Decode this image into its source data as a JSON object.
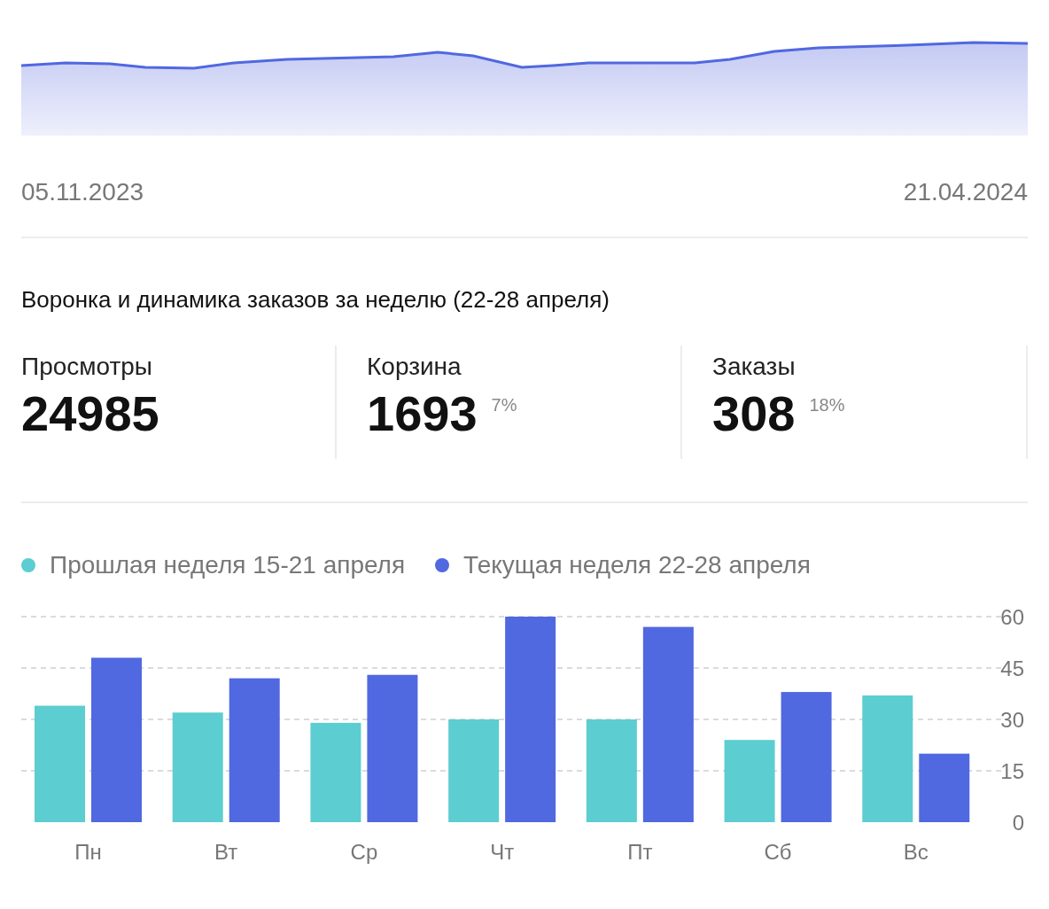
{
  "sparkline": {
    "start_date": "05.11.2023",
    "end_date": "21.04.2024"
  },
  "funnel": {
    "title": "Воронка и динамика заказов за неделю (22-28 апреля)",
    "metrics": [
      {
        "label": "Просмотры",
        "value": "24985"
      },
      {
        "label": "Корзина",
        "value": "1693",
        "percent": "7%"
      },
      {
        "label": "Заказы",
        "value": "308",
        "percent": "18%"
      }
    ]
  },
  "orders_chart": {
    "chart_data": {
      "type": "bar",
      "grid": true,
      "categories": [
        "Пн",
        "Вт",
        "Ср",
        "Чт",
        "Пт",
        "Сб",
        "Вс"
      ],
      "ylim": [
        0,
        60
      ],
      "yticks": [
        0,
        15,
        30,
        45,
        60
      ],
      "series": [
        {
          "name": "Прошлая неделя 15-21 апреля",
          "color": "#5ccdd0",
          "values": [
            34,
            32,
            29,
            30,
            30,
            24,
            37
          ]
        },
        {
          "name": "Текущая неделя 22-28 апреля",
          "color": "#5068e0",
          "values": [
            48,
            42,
            43,
            60,
            57,
            38,
            20
          ]
        }
      ]
    }
  }
}
